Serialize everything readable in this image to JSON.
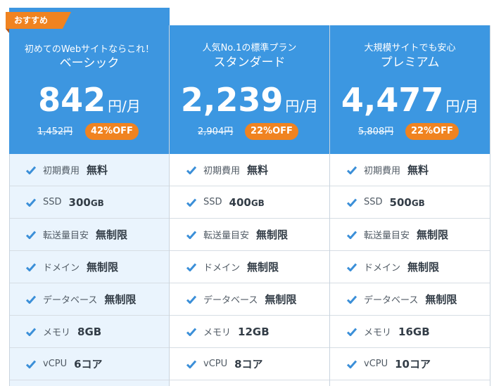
{
  "ribbon": "おすすめ",
  "currency_unit": "円/月",
  "plans": [
    {
      "subtitle": "初めてのWebサイトならこれ！",
      "name": "ベーシック",
      "price": "842",
      "old_price": "1,452円",
      "discount": "42%OFF",
      "features": [
        {
          "label": "初期費用",
          "value": "無料",
          "unit": ""
        },
        {
          "label": "SSD",
          "value": "300",
          "unit": "GB"
        },
        {
          "label": "転送量目安",
          "value": "無制限",
          "unit": ""
        },
        {
          "label": "ドメイン",
          "value": "無制限",
          "unit": ""
        },
        {
          "label": "データベース",
          "value": "無制限",
          "unit": ""
        },
        {
          "label": "メモリ",
          "value": "8GB",
          "unit": ""
        },
        {
          "label": "vCPU",
          "value": "6コア",
          "unit": ""
        }
      ]
    },
    {
      "subtitle": "人気No.1の標準プラン",
      "name": "スタンダード",
      "price": "2,239",
      "old_price": "2,904円",
      "discount": "22%OFF",
      "features": [
        {
          "label": "初期費用",
          "value": "無料",
          "unit": ""
        },
        {
          "label": "SSD",
          "value": "400",
          "unit": "GB"
        },
        {
          "label": "転送量目安",
          "value": "無制限",
          "unit": ""
        },
        {
          "label": "ドメイン",
          "value": "無制限",
          "unit": ""
        },
        {
          "label": "データベース",
          "value": "無制限",
          "unit": ""
        },
        {
          "label": "メモリ",
          "value": "12GB",
          "unit": ""
        },
        {
          "label": "vCPU",
          "value": "8コア",
          "unit": ""
        }
      ]
    },
    {
      "subtitle": "大規模サイトでも安心",
      "name": "プレミアム",
      "price": "4,477",
      "old_price": "5,808円",
      "discount": "22%OFF",
      "features": [
        {
          "label": "初期費用",
          "value": "無料",
          "unit": ""
        },
        {
          "label": "SSD",
          "value": "500",
          "unit": "GB"
        },
        {
          "label": "転送量目安",
          "value": "無制限",
          "unit": ""
        },
        {
          "label": "ドメイン",
          "value": "無制限",
          "unit": ""
        },
        {
          "label": "データベース",
          "value": "無制限",
          "unit": ""
        },
        {
          "label": "メモリ",
          "value": "16GB",
          "unit": ""
        },
        {
          "label": "vCPU",
          "value": "10コア",
          "unit": ""
        }
      ]
    }
  ],
  "colors": {
    "header_blue": "#3d96e0",
    "accent_orange": "#f08320",
    "featured_body": "#eaf4fd",
    "check": "#3b8fd8"
  }
}
